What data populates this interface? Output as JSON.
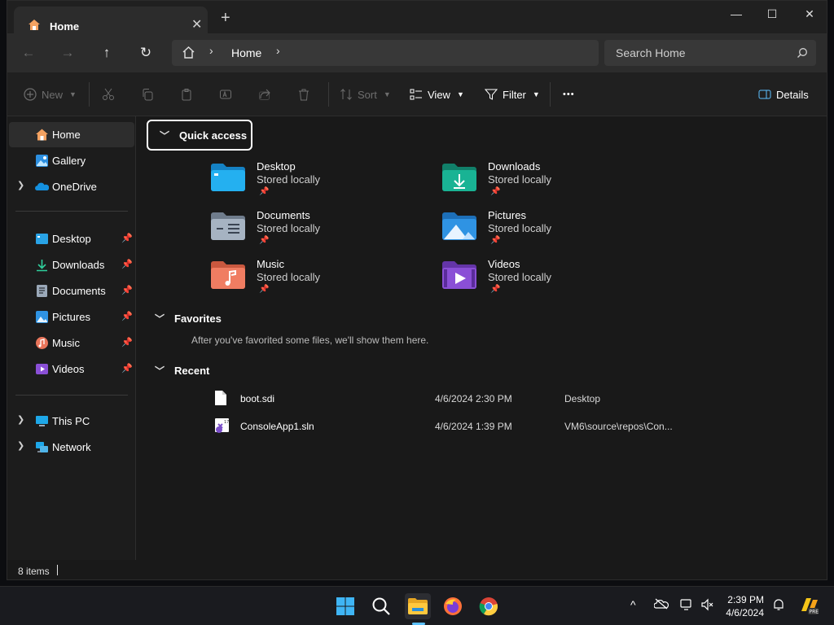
{
  "window": {
    "tab_title": "Home",
    "tab_close": "✕",
    "new_tab": "+",
    "minimize": "—",
    "maximize": "☐",
    "close": "✕"
  },
  "nav": {
    "back": "←",
    "forward": "→",
    "up": "↑",
    "refresh": "↻",
    "breadcrumb": "Home",
    "search_placeholder": "Search Home"
  },
  "command_bar": {
    "new": "New",
    "sort": "Sort",
    "view": "View",
    "filter": "Filter",
    "more": "•••",
    "details": "Details"
  },
  "sidebar": {
    "top": [
      {
        "label": "Home",
        "icon": "home-icon",
        "selected": true
      },
      {
        "label": "Gallery",
        "icon": "gallery-icon"
      },
      {
        "label": "OneDrive",
        "icon": "onedrive-icon",
        "expandable": true
      }
    ],
    "pinned": [
      {
        "label": "Desktop",
        "icon": "desktop-folder-icon"
      },
      {
        "label": "Downloads",
        "icon": "downloads-icon"
      },
      {
        "label": "Documents",
        "icon": "documents-icon"
      },
      {
        "label": "Pictures",
        "icon": "pictures-icon"
      },
      {
        "label": "Music",
        "icon": "music-icon"
      },
      {
        "label": "Videos",
        "icon": "videos-icon"
      }
    ],
    "bottom": [
      {
        "label": "This PC",
        "icon": "this-pc-icon"
      },
      {
        "label": "Network",
        "icon": "network-icon"
      }
    ]
  },
  "quick_access": {
    "heading": "Quick access",
    "items": [
      {
        "name": "Desktop",
        "status": "Stored locally",
        "color": "#1ea7e8"
      },
      {
        "name": "Downloads",
        "status": "Stored locally",
        "color": "#17a58a"
      },
      {
        "name": "Documents",
        "status": "Stored locally",
        "color": "#9aa8b8"
      },
      {
        "name": "Pictures",
        "status": "Stored locally",
        "color": "#2f93e3"
      },
      {
        "name": "Music",
        "status": "Stored locally",
        "color": "#e8745a"
      },
      {
        "name": "Videos",
        "status": "Stored locally",
        "color": "#8a4fd6"
      }
    ]
  },
  "favorites": {
    "heading": "Favorites",
    "empty_text": "After you've favorited some files, we'll show them here."
  },
  "recent": {
    "heading": "Recent",
    "rows": [
      {
        "name": "boot.sdi",
        "date": "4/6/2024 2:30 PM",
        "location": "Desktop",
        "icon": "file-icon"
      },
      {
        "name": "ConsoleApp1.sln",
        "date": "4/6/2024 1:39 PM",
        "location": "VM6\\source\\repos\\Con...",
        "icon": "visual-studio-solution-icon"
      }
    ]
  },
  "status": {
    "items_count": "8 items"
  },
  "taskbar": {
    "time": "2:39 PM",
    "date": "4/6/2024",
    "chevron_up": "^"
  },
  "colors": {
    "accent": "#5cc1ff",
    "home_icon": "#f4a261"
  }
}
